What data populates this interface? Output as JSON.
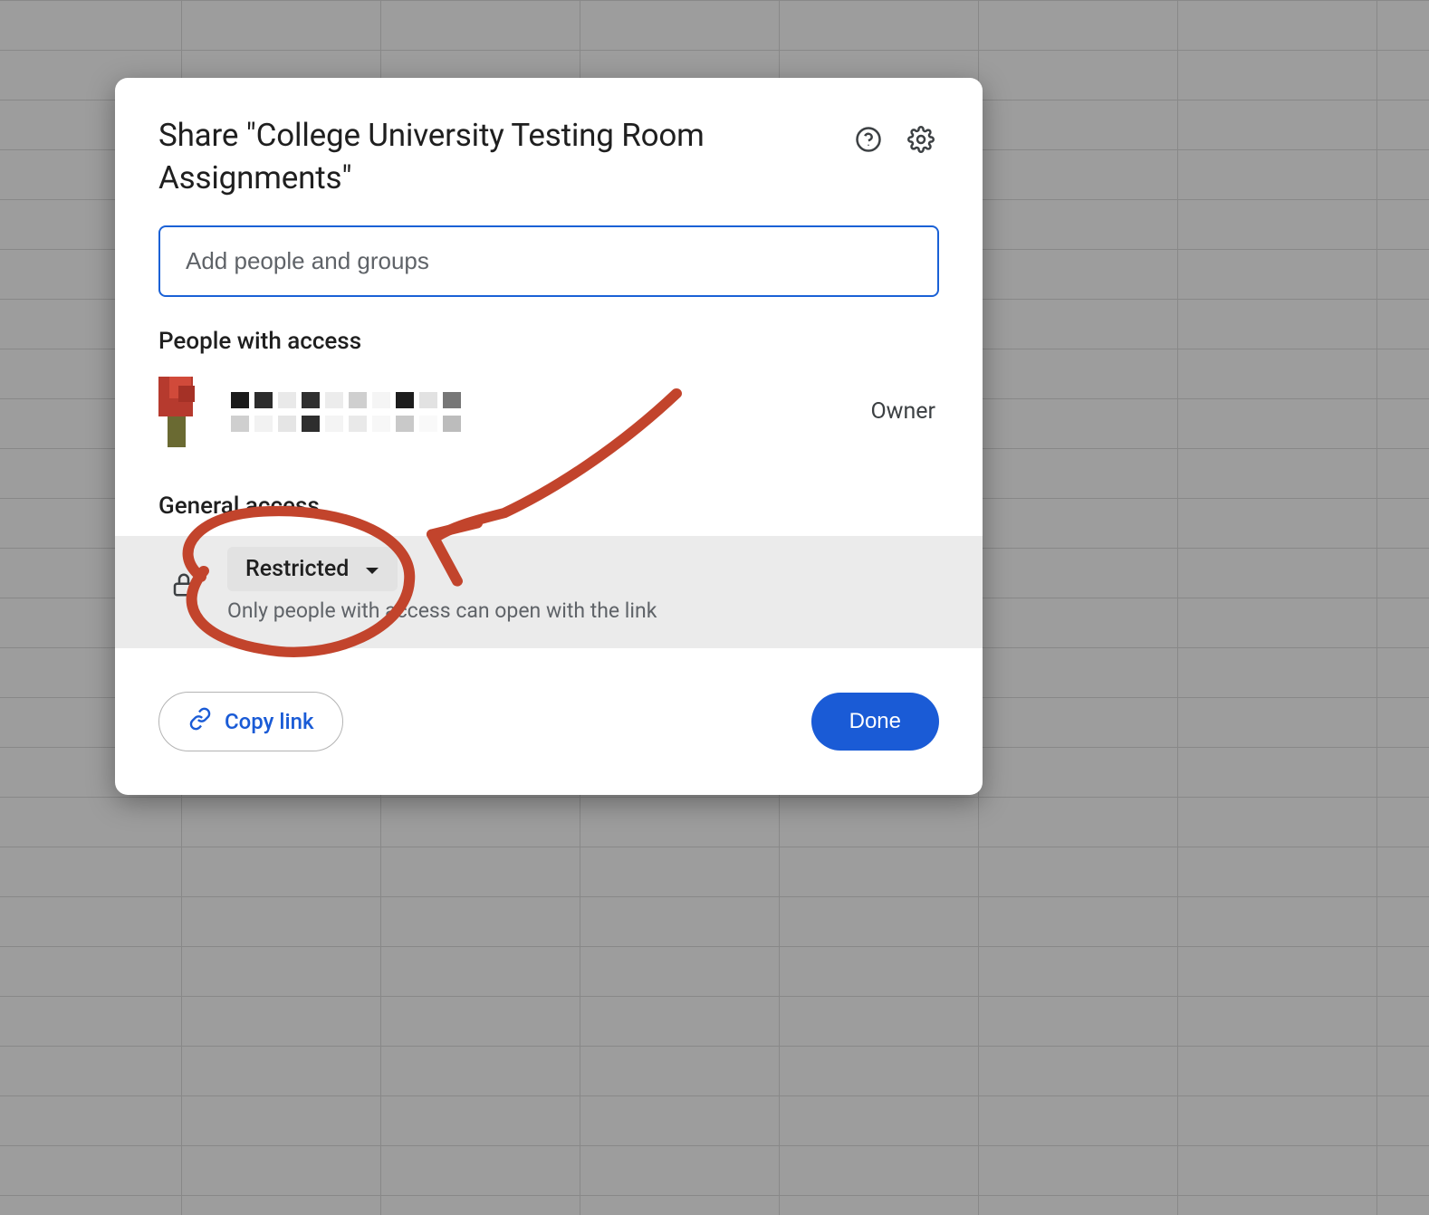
{
  "dialog": {
    "title": "Share \"College University Testing Room Assignments\"",
    "input_placeholder": "Add people and groups"
  },
  "sections": {
    "people_heading": "People with access",
    "general_heading": "General access"
  },
  "person": {
    "role": "Owner"
  },
  "access": {
    "selected": "Restricted",
    "description": "Only people with access can open with the link"
  },
  "footer": {
    "copy_link": "Copy link",
    "done": "Done"
  },
  "colors": {
    "accent_blue": "#1a5bd6",
    "annotation_red": "#c2442c"
  }
}
